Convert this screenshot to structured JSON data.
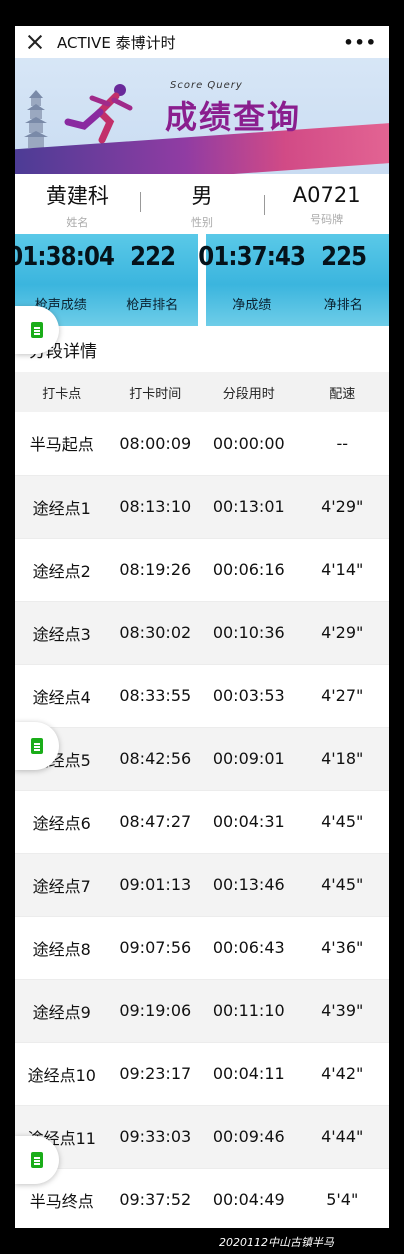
{
  "topbar": {
    "title": "ACTIVE 泰博计时",
    "more": "•••"
  },
  "banner": {
    "subtitle": "Score Query",
    "title": "成绩查询"
  },
  "person": {
    "name": "黄建科",
    "name_label": "姓名",
    "gender": "男",
    "gender_label": "性别",
    "bib": "A0721",
    "bib_label": "号码牌"
  },
  "scores": {
    "gun_time": "01:38:04",
    "gun_rank": "222",
    "gun_time_label": "枪声成绩",
    "gun_rank_label": "枪声排名",
    "net_time": "01:37:43",
    "net_rank": "225",
    "net_time_label": "净成绩",
    "net_rank_label": "净排名"
  },
  "splits": {
    "title": "分段详情",
    "headers": [
      "打卡点",
      "打卡时间",
      "分段用时",
      "配速"
    ],
    "rows": [
      [
        "半马起点",
        "08:00:09",
        "00:00:00",
        "--"
      ],
      [
        "途经点1",
        "08:13:10",
        "00:13:01",
        "4'29\""
      ],
      [
        "途经点2",
        "08:19:26",
        "00:06:16",
        "4'14\""
      ],
      [
        "途经点3",
        "08:30:02",
        "00:10:36",
        "4'29\""
      ],
      [
        "途经点4",
        "08:33:55",
        "00:03:53",
        "4'27\""
      ],
      [
        "途经点5",
        "08:42:56",
        "00:09:01",
        "4'18\""
      ],
      [
        "途经点6",
        "08:47:27",
        "00:04:31",
        "4'45\""
      ],
      [
        "途经点7",
        "09:01:13",
        "00:13:46",
        "4'45\""
      ],
      [
        "途经点8",
        "09:07:56",
        "00:06:43",
        "4'36\""
      ],
      [
        "途经点9",
        "09:19:06",
        "00:11:10",
        "4'39\""
      ],
      [
        "途经点10",
        "09:23:17",
        "00:04:11",
        "4'42\""
      ],
      [
        "途经点11",
        "09:33:03",
        "00:09:46",
        "4'44\""
      ],
      [
        "半马终点",
        "09:37:52",
        "00:04:49",
        "5'4\""
      ]
    ]
  },
  "caption": "2020112中山古镇半马",
  "colors": {
    "score_bg": "#3bb5de",
    "banner_accent": "#8a1e8e",
    "float_doc": "#1aad19"
  },
  "icons": {
    "close": "close-icon",
    "more": "more-icon",
    "doc": "document-icon"
  }
}
